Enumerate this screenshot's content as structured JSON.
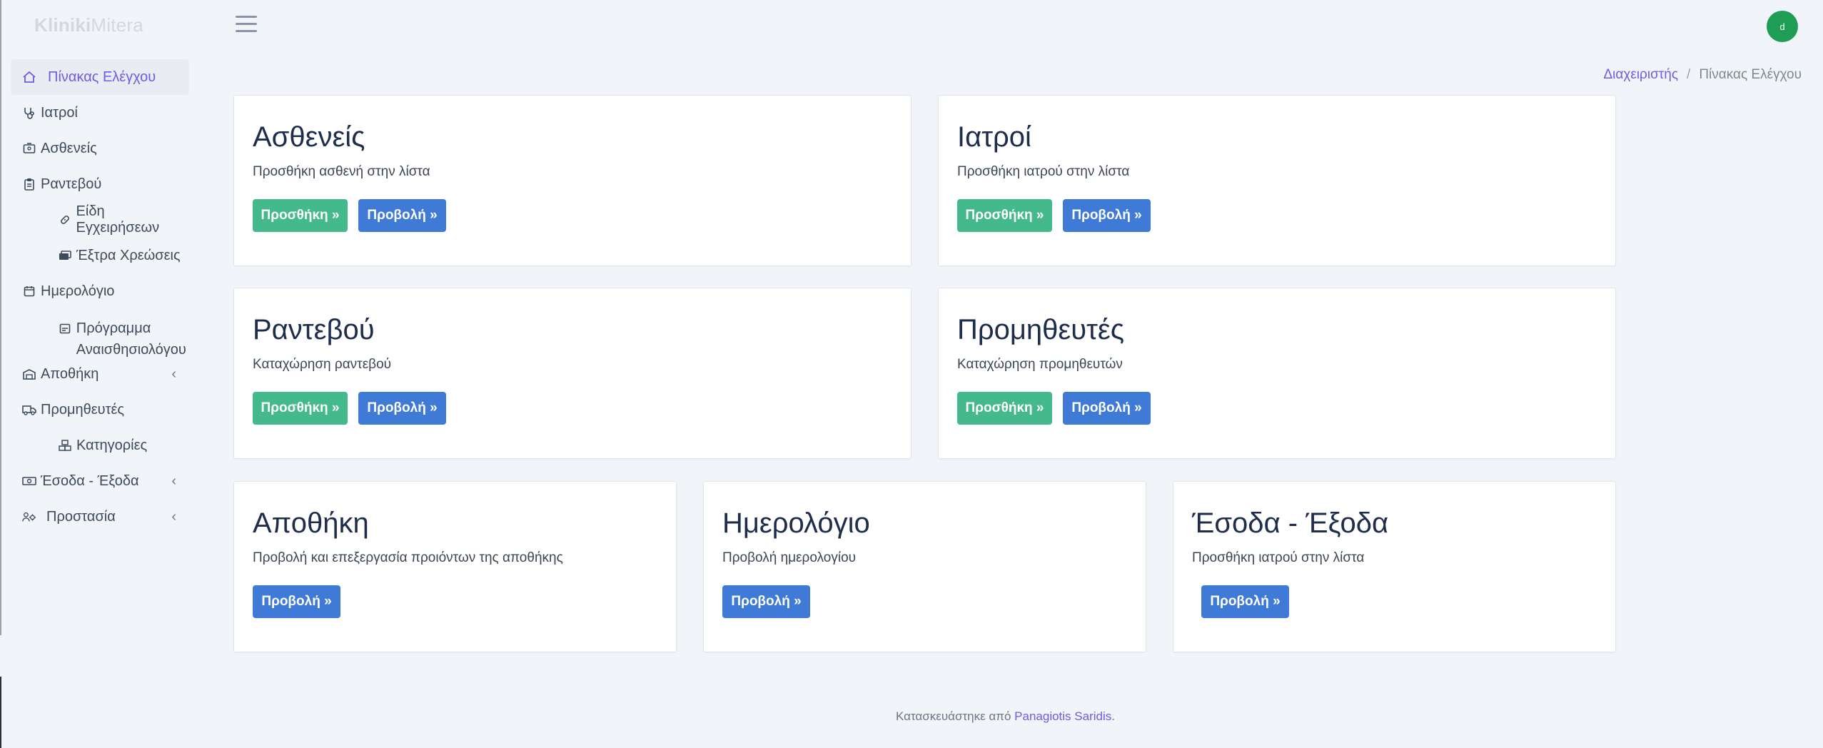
{
  "brand": {
    "bold": "Kliniki",
    "light": "Mitera"
  },
  "user": {
    "avatar_initial": "d"
  },
  "sidebar": {
    "items": [
      {
        "label": "Πίνακας Ελέγχου",
        "icon": "home-icon"
      },
      {
        "label": "Ιατροί",
        "icon": "stethoscope-icon"
      },
      {
        "label": "Ασθενείς",
        "icon": "id-card-icon"
      },
      {
        "label": "Ραντεβού",
        "icon": "clipboard-icon"
      },
      {
        "label": "Είδη Εγχειρήσεων",
        "icon": "bandage-icon"
      },
      {
        "label": "Έξτρα Χρεώσεις",
        "icon": "money-icon"
      },
      {
        "label": "Ημερολόγιο",
        "icon": "calendar-icon"
      },
      {
        "label": "Πρόγραμμα Αναισθησιολόγου",
        "icon": "schedule-icon"
      },
      {
        "label": "Αποθήκη",
        "icon": "warehouse-icon",
        "chevron": "‹"
      },
      {
        "label": "Προμηθευτές",
        "icon": "truck-icon"
      },
      {
        "label": "Κατηγορίες",
        "icon": "boxes-icon"
      },
      {
        "label": "Έσοδα - Έξοδα",
        "icon": "cash-icon",
        "chevron": "‹"
      },
      {
        "label": "Προστασία",
        "icon": "users-cog-icon",
        "chevron": "‹"
      }
    ]
  },
  "breadcrumb": {
    "root": "Διαχειριστής",
    "separator": "/",
    "current": "Πίνακας Ελέγχου"
  },
  "cards": [
    {
      "title": "Ασθενείς",
      "description": "Προσθήκη ασθενή στην λίστα",
      "add_label": "Προσθήκη »",
      "view_label": "Προβολή »"
    },
    {
      "title": "Ιατροί",
      "description": "Προσθήκη ιατρού στην λίστα",
      "add_label": "Προσθήκη »",
      "view_label": "Προβολή »"
    },
    {
      "title": "Ραντεβού",
      "description": "Καταχώρηση ραντεβού",
      "add_label": "Προσθήκη »",
      "view_label": "Προβολή »"
    },
    {
      "title": "Προμηθευτές",
      "description": "Καταχώρηση προμηθευτών",
      "add_label": "Προσθήκη »",
      "view_label": "Προβολή »"
    },
    {
      "title": "Αποθήκη",
      "description": "Προβολή και επεξεργασία προιόντων της αποθήκης",
      "view_label": "Προβολή »"
    },
    {
      "title": "Ημερολόγιο",
      "description": "Προβολή ημερολογίου",
      "view_label": "Προβολή »"
    },
    {
      "title": "Έσοδα - Έξοδα",
      "description": "Προσθήκη ιατρού στην λίστα",
      "view_label": "Προβολή »"
    }
  ],
  "footer": {
    "text": "Κατασκευάστηκε από",
    "author": "Panagiotis Saridis",
    "end": "."
  },
  "colors": {
    "accent": "#6c5ce7",
    "green_button": "#43b98c",
    "blue_button": "#3f7bd6",
    "avatar": "#1f9d55",
    "background": "#f1f4f9"
  }
}
